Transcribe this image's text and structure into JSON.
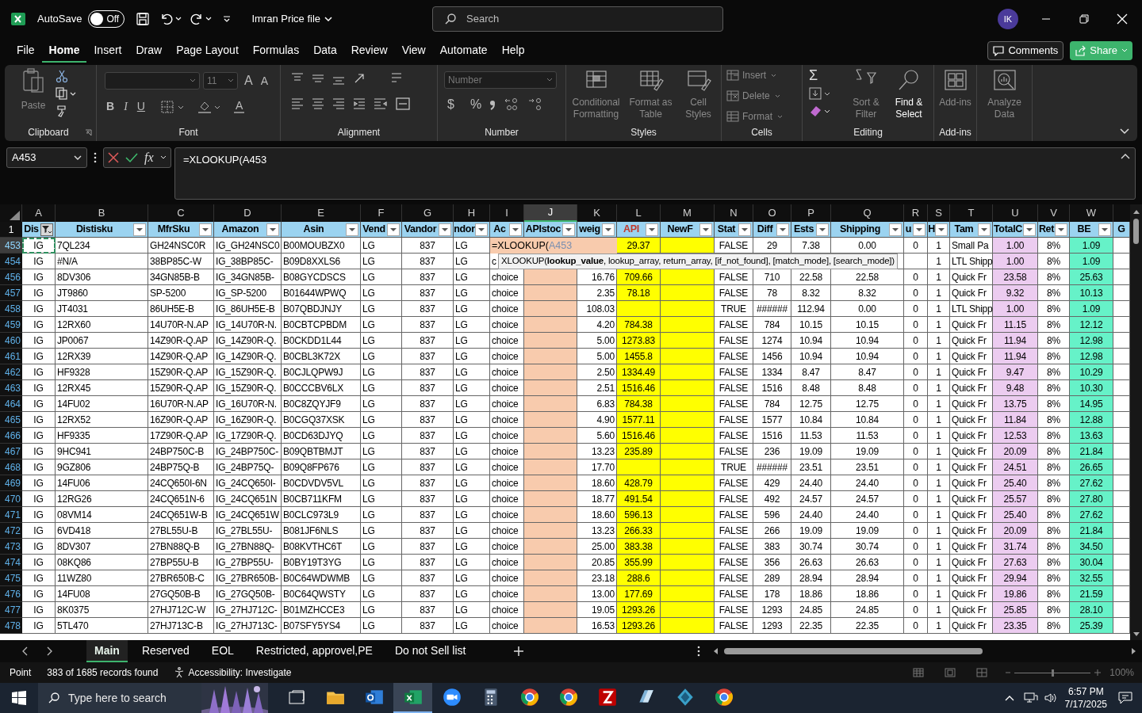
{
  "title_bar": {
    "autosave_label": "AutoSave",
    "autosave_on": false,
    "autosave_state": "Off",
    "file_name": "Imran Price file",
    "search_placeholder": "Search",
    "avatar": "IK"
  },
  "menu_tabs": [
    {
      "label": "File",
      "selected": false
    },
    {
      "label": "Home",
      "selected": true
    },
    {
      "label": "Insert",
      "selected": false
    },
    {
      "label": "Draw",
      "selected": false
    },
    {
      "label": "Page Layout",
      "selected": false
    },
    {
      "label": "Formulas",
      "selected": false
    },
    {
      "label": "Data",
      "selected": false
    },
    {
      "label": "Review",
      "selected": false
    },
    {
      "label": "View",
      "selected": false
    },
    {
      "label": "Automate",
      "selected": false
    },
    {
      "label": "Help",
      "selected": false
    }
  ],
  "actions": {
    "comments": "Comments",
    "share": "Share"
  },
  "ribbon": {
    "clipboard": {
      "label": "Clipboard",
      "paste": {
        "label": "Paste",
        "disabled": true
      }
    },
    "font": {
      "label": "Font",
      "size": "11",
      "grow": "A",
      "shrink": "A",
      "bold": "B",
      "italic": "I",
      "underline": "U",
      "font_color": "A"
    },
    "alignment": {
      "label": "Alignment"
    },
    "number": {
      "label": "Number",
      "format": "Number",
      "currency": "$",
      "percent": "%"
    },
    "styles": {
      "label": "Styles",
      "buttons": [
        {
          "label": "Conditional Formatting",
          "disabled": true
        },
        {
          "label": "Format as Table",
          "disabled": true
        },
        {
          "label": "Cell Styles",
          "disabled": true
        }
      ]
    },
    "cells": {
      "label": "Cells",
      "buttons": [
        {
          "label": "Insert",
          "disabled": true
        },
        {
          "label": "Delete",
          "disabled": true
        },
        {
          "label": "Format",
          "disabled": true
        }
      ]
    },
    "editing": {
      "label": "Editing",
      "sum": "Σ",
      "buttons": [
        {
          "label": "Sort & Filter",
          "disabled": true
        },
        {
          "label": "Find & Select",
          "disabled": false
        }
      ]
    },
    "addins": {
      "label": "Add-ins",
      "buttons": [
        {
          "label": "Add-ins",
          "disabled": true
        }
      ]
    },
    "analyze": {
      "buttons": [
        {
          "label": "Analyze Data",
          "disabled": true
        }
      ]
    }
  },
  "formula_bar": {
    "name_box": "A453",
    "function_button": "fx",
    "formula": "=XLOOKUP(A453"
  },
  "sheet": {
    "column_letters": [
      {
        "letter": "A",
        "selected": false
      },
      {
        "letter": "B",
        "selected": false
      },
      {
        "letter": "C",
        "selected": false
      },
      {
        "letter": "D",
        "selected": false
      },
      {
        "letter": "E",
        "selected": false
      },
      {
        "letter": "F",
        "selected": false
      },
      {
        "letter": "G",
        "selected": false
      },
      {
        "letter": "H",
        "selected": false
      },
      {
        "letter": "I",
        "selected": false
      },
      {
        "letter": "J",
        "selected": true
      },
      {
        "letter": "K",
        "selected": false
      },
      {
        "letter": "L",
        "selected": false
      },
      {
        "letter": "M",
        "selected": false
      },
      {
        "letter": "N",
        "selected": false
      },
      {
        "letter": "O",
        "selected": false
      },
      {
        "letter": "P",
        "selected": false
      },
      {
        "letter": "Q",
        "selected": false
      },
      {
        "letter": "R",
        "selected": false
      },
      {
        "letter": "S",
        "selected": false
      },
      {
        "letter": "T",
        "selected": false
      },
      {
        "letter": "U",
        "selected": false
      },
      {
        "letter": "V",
        "selected": false
      },
      {
        "letter": "W",
        "selected": false
      }
    ],
    "header_row": "1",
    "headers": [
      {
        "text": "Dis",
        "filtered": true
      },
      {
        "text": "Distisku",
        "filtered": false
      },
      {
        "text": "MfrSku",
        "filtered": false
      },
      {
        "text": "Amazon",
        "filtered": false
      },
      {
        "text": "Asin",
        "filtered": false
      },
      {
        "text": "Vend",
        "filtered": false
      },
      {
        "text": "Vandor",
        "filtered": false
      },
      {
        "text": "ndor",
        "filtered": false
      },
      {
        "text": "Ac",
        "filtered": false
      },
      {
        "text": "APIstoc",
        "filtered": false
      },
      {
        "text": "weig",
        "filtered": false
      },
      {
        "text": "API",
        "filtered": false
      },
      {
        "text": "NewF",
        "filtered": false
      },
      {
        "text": "Stat",
        "filtered": false
      },
      {
        "text": "Diff",
        "filtered": false
      },
      {
        "text": "Ests",
        "filtered": false
      },
      {
        "text": "Shipping",
        "filtered": false
      },
      {
        "text": "u",
        "filtered": false
      },
      {
        "text": "H",
        "filtered": false
      },
      {
        "text": "Tam",
        "filtered": false
      },
      {
        "text": "TotalC",
        "filtered": false
      },
      {
        "text": "Ret",
        "filtered": false
      },
      {
        "text": "BE",
        "filtered": false
      },
      {
        "text": "G"
      }
    ],
    "editor": {
      "function": "=XLOOKUP(",
      "reference": "A453"
    },
    "tooltip": "XLOOKUP(**lookup_value**, lookup_array, return_array, [if_not_found], [match_mode], [search_mode])",
    "rows": [
      {
        "number": "453",
        "selected": true,
        "marquee": true,
        "cells": {
          "A": "IG",
          "B": "7QL234",
          "C": "GH24NSC0R",
          "D": "IG_GH24NSC0",
          "E": "B00MOUBZX0",
          "F": "LG",
          "G": "837",
          "H": "LG",
          "L": "29.37",
          "N": "FALSE",
          "O": "29",
          "P": "7.38",
          "Q": "0.00",
          "R": "0",
          "S": "1",
          "T": "Small Pa",
          "U": "1.00",
          "V": "8%",
          "W": "1.09"
        }
      },
      {
        "number": "454",
        "selected": false,
        "marquee": false,
        "cells": {
          "A": "IG",
          "B": "#N/A",
          "C": "38BP85C-W",
          "D": "IG_38BP85C-",
          "E": "B09D8XXLS6",
          "F": "LG",
          "G": "837",
          "H": "LG",
          "I": "c",
          "S": "1",
          "T": "LTL Shipp",
          "U": "1.00",
          "V": "8%",
          "W": "1.09"
        }
      },
      {
        "number": "456",
        "selected": false,
        "marquee": false,
        "cells": {
          "A": "IG",
          "B": "8DV306",
          "C": "34GN85B-B",
          "D": "IG_34GN85B-",
          "E": "B08GYCDSCS",
          "F": "LG",
          "G": "837",
          "H": "LG",
          "I": "choice",
          "K": "16.76",
          "L": "709.66",
          "N": "FALSE",
          "O": "710",
          "P": "22.58",
          "Q": "22.58",
          "R": "0",
          "S": "1",
          "T": "Quick Fr",
          "U": "23.58",
          "V": "8%",
          "W": "25.63"
        }
      },
      {
        "number": "457",
        "selected": false,
        "marquee": false,
        "cells": {
          "A": "IG",
          "B": "JT9860",
          "C": "SP-5200",
          "D": "IG_SP-5200",
          "E": "B01644WPWQ",
          "F": "LG",
          "G": "837",
          "H": "LG",
          "I": "choice",
          "K": "2.35",
          "L": "78.18",
          "N": "FALSE",
          "O": "78",
          "P": "8.32",
          "Q": "8.32",
          "R": "0",
          "S": "1",
          "T": "Quick Fr",
          "U": "9.32",
          "V": "8%",
          "W": "10.13"
        }
      },
      {
        "number": "458",
        "selected": false,
        "marquee": false,
        "cells": {
          "A": "IG",
          "B": "JT4031",
          "C": "86UH5E-B",
          "D": "IG_86UH5E-B",
          "E": "B07QBDJNJY",
          "F": "LG",
          "G": "837",
          "H": "LG",
          "I": "choice",
          "K": "108.03",
          "N": "TRUE",
          "O": "######",
          "P": "112.94",
          "Q": "0.00",
          "R": "0",
          "S": "1",
          "T": "LTL Shipp",
          "U": "1.00",
          "V": "8%",
          "W": "1.09"
        }
      },
      {
        "number": "459",
        "selected": false,
        "marquee": false,
        "cells": {
          "A": "IG",
          "B": "12RX60",
          "C": "14U70R-N.AP",
          "D": "IG_14U70R-N.",
          "E": "B0CBTCPBDM",
          "F": "LG",
          "G": "837",
          "H": "LG",
          "I": "choice",
          "K": "4.20",
          "L": "784.38",
          "N": "FALSE",
          "O": "784",
          "P": "10.15",
          "Q": "10.15",
          "R": "0",
          "S": "1",
          "T": "Quick Fr",
          "U": "11.15",
          "V": "8%",
          "W": "12.12"
        }
      },
      {
        "number": "460",
        "selected": false,
        "marquee": false,
        "cells": {
          "A": "IG",
          "B": "JP0067",
          "C": "14Z90R-Q.AP",
          "D": "IG_14Z90R-Q.",
          "E": "B0CKDD1L44",
          "F": "LG",
          "G": "837",
          "H": "LG",
          "I": "choice",
          "K": "5.00",
          "L": "1273.83",
          "N": "FALSE",
          "O": "1274",
          "P": "10.94",
          "Q": "10.94",
          "R": "0",
          "S": "1",
          "T": "Quick Fr",
          "U": "11.94",
          "V": "8%",
          "W": "12.98"
        }
      },
      {
        "number": "461",
        "selected": false,
        "marquee": false,
        "cells": {
          "A": "IG",
          "B": "12RX39",
          "C": "14Z90R-Q.AP",
          "D": "IG_14Z90R-Q.",
          "E": "B0CBL3K72X",
          "F": "LG",
          "G": "837",
          "H": "LG",
          "I": "choice",
          "K": "5.00",
          "L": "1455.8",
          "N": "FALSE",
          "O": "1456",
          "P": "10.94",
          "Q": "10.94",
          "R": "0",
          "S": "1",
          "T": "Quick Fr",
          "U": "11.94",
          "V": "8%",
          "W": "12.98"
        }
      },
      {
        "number": "462",
        "selected": false,
        "marquee": false,
        "cells": {
          "A": "IG",
          "B": "HF9328",
          "C": "15Z90R-Q.AP",
          "D": "IG_15Z90R-Q.",
          "E": "B0CJLQPW9J",
          "F": "LG",
          "G": "837",
          "H": "LG",
          "I": "choice",
          "K": "2.50",
          "L": "1334.49",
          "N": "FALSE",
          "O": "1334",
          "P": "8.47",
          "Q": "8.47",
          "R": "0",
          "S": "1",
          "T": "Quick Fr",
          "U": "9.47",
          "V": "8%",
          "W": "10.29"
        }
      },
      {
        "number": "463",
        "selected": false,
        "marquee": false,
        "cells": {
          "A": "IG",
          "B": "12RX45",
          "C": "15Z90R-Q.AP",
          "D": "IG_15Z90R-Q.",
          "E": "B0CCCBV6LX",
          "F": "LG",
          "G": "837",
          "H": "LG",
          "I": "choice",
          "K": "2.51",
          "L": "1516.46",
          "N": "FALSE",
          "O": "1516",
          "P": "8.48",
          "Q": "8.48",
          "R": "0",
          "S": "1",
          "T": "Quick Fr",
          "U": "9.48",
          "V": "8%",
          "W": "10.30"
        }
      },
      {
        "number": "464",
        "selected": false,
        "marquee": false,
        "cells": {
          "A": "IG",
          "B": "14FU02",
          "C": "16U70R-N.AP",
          "D": "IG_16U70R-N.",
          "E": "B0C8ZQYJF9",
          "F": "LG",
          "G": "837",
          "H": "LG",
          "I": "choice",
          "K": "6.83",
          "L": "784.38",
          "N": "FALSE",
          "O": "784",
          "P": "12.75",
          "Q": "12.75",
          "R": "0",
          "S": "1",
          "T": "Quick Fr",
          "U": "13.75",
          "V": "8%",
          "W": "14.95"
        }
      },
      {
        "number": "465",
        "selected": false,
        "marquee": false,
        "cells": {
          "A": "IG",
          "B": "12RX52",
          "C": "16Z90R-Q.AP",
          "D": "IG_16Z90R-Q.",
          "E": "B0CGQ37XSK",
          "F": "LG",
          "G": "837",
          "H": "LG",
          "I": "choice",
          "K": "4.90",
          "L": "1577.11",
          "N": "FALSE",
          "O": "1577",
          "P": "10.84",
          "Q": "10.84",
          "R": "0",
          "S": "1",
          "T": "Quick Fr",
          "U": "11.84",
          "V": "8%",
          "W": "12.88"
        }
      },
      {
        "number": "466",
        "selected": false,
        "marquee": false,
        "cells": {
          "A": "IG",
          "B": "HF9335",
          "C": "17Z90R-Q.AP",
          "D": "IG_17Z90R-Q.",
          "E": "B0CD63DJYQ",
          "F": "LG",
          "G": "837",
          "H": "LG",
          "I": "choice",
          "K": "5.60",
          "L": "1516.46",
          "N": "FALSE",
          "O": "1516",
          "P": "11.53",
          "Q": "11.53",
          "R": "0",
          "S": "1",
          "T": "Quick Fr",
          "U": "12.53",
          "V": "8%",
          "W": "13.63"
        }
      },
      {
        "number": "467",
        "selected": false,
        "marquee": false,
        "cells": {
          "A": "IG",
          "B": "9HC941",
          "C": "24BP750C-B",
          "D": "IG_24BP750C-",
          "E": "B09QBTBMJT",
          "F": "LG",
          "G": "837",
          "H": "LG",
          "I": "choice",
          "K": "13.23",
          "L": "235.89",
          "N": "FALSE",
          "O": "236",
          "P": "19.09",
          "Q": "19.09",
          "R": "0",
          "S": "1",
          "T": "Quick Fr",
          "U": "20.09",
          "V": "8%",
          "W": "21.84"
        }
      },
      {
        "number": "468",
        "selected": false,
        "marquee": false,
        "cells": {
          "A": "IG",
          "B": "9GZ806",
          "C": "24BP75Q-B",
          "D": "IG_24BP75Q-",
          "E": "B09Q8FP676",
          "F": "LG",
          "G": "837",
          "H": "LG",
          "I": "choice",
          "K": "17.70",
          "N": "TRUE",
          "O": "######",
          "P": "23.51",
          "Q": "23.51",
          "R": "0",
          "S": "1",
          "T": "Quick Fr",
          "U": "24.51",
          "V": "8%",
          "W": "26.65"
        }
      },
      {
        "number": "469",
        "selected": false,
        "marquee": false,
        "cells": {
          "A": "IG",
          "B": "14FU06",
          "C": "24CQ650I-6N",
          "D": "IG_24CQ650I-",
          "E": "B0CDVDV5VL",
          "F": "LG",
          "G": "837",
          "H": "LG",
          "I": "choice",
          "K": "18.60",
          "L": "428.79",
          "N": "FALSE",
          "O": "429",
          "P": "24.40",
          "Q": "24.40",
          "R": "0",
          "S": "1",
          "T": "Quick Fr",
          "U": "25.40",
          "V": "8%",
          "W": "27.62"
        }
      },
      {
        "number": "470",
        "selected": false,
        "marquee": false,
        "cells": {
          "A": "IG",
          "B": "12RG26",
          "C": "24CQ651N-6",
          "D": "IG_24CQ651N",
          "E": "B0CB711KFM",
          "F": "LG",
          "G": "837",
          "H": "LG",
          "I": "choice",
          "K": "18.77",
          "L": "491.54",
          "N": "FALSE",
          "O": "492",
          "P": "24.57",
          "Q": "24.57",
          "R": "0",
          "S": "1",
          "T": "Quick Fr",
          "U": "25.57",
          "V": "8%",
          "W": "27.80"
        }
      },
      {
        "number": "471",
        "selected": false,
        "marquee": false,
        "cells": {
          "A": "IG",
          "B": "08VM14",
          "C": "24CQ651W-B",
          "D": "IG_24CQ651W",
          "E": "B0CLC973L9",
          "F": "LG",
          "G": "837",
          "H": "LG",
          "I": "choice",
          "K": "18.60",
          "L": "596.13",
          "N": "FALSE",
          "O": "596",
          "P": "24.40",
          "Q": "24.40",
          "R": "0",
          "S": "1",
          "T": "Quick Fr",
          "U": "25.40",
          "V": "8%",
          "W": "27.62"
        }
      },
      {
        "number": "472",
        "selected": false,
        "marquee": false,
        "cells": {
          "A": "IG",
          "B": "6VD418",
          "C": "27BL55U-B",
          "D": "IG_27BL55U-",
          "E": "B081JF6NLS",
          "F": "LG",
          "G": "837",
          "H": "LG",
          "I": "choice",
          "K": "13.23",
          "L": "266.33",
          "N": "FALSE",
          "O": "266",
          "P": "19.09",
          "Q": "19.09",
          "R": "0",
          "S": "1",
          "T": "Quick Fr",
          "U": "20.09",
          "V": "8%",
          "W": "21.84"
        }
      },
      {
        "number": "473",
        "selected": false,
        "marquee": false,
        "cells": {
          "A": "IG",
          "B": "8DV307",
          "C": "27BN88Q-B",
          "D": "IG_27BN88Q-",
          "E": "B08KVTHC6T",
          "F": "LG",
          "G": "837",
          "H": "LG",
          "I": "choice",
          "K": "25.00",
          "L": "383.38",
          "N": "FALSE",
          "O": "383",
          "P": "30.74",
          "Q": "30.74",
          "R": "0",
          "S": "1",
          "T": "Quick Fr",
          "U": "31.74",
          "V": "8%",
          "W": "34.50"
        }
      },
      {
        "number": "474",
        "selected": false,
        "marquee": false,
        "cells": {
          "A": "IG",
          "B": "08KQ86",
          "C": "27BP55U-B",
          "D": "IG_27BP55U-",
          "E": "B0BY19T3YG",
          "F": "LG",
          "G": "837",
          "H": "LG",
          "I": "choice",
          "K": "20.85",
          "L": "355.99",
          "N": "FALSE",
          "O": "356",
          "P": "26.63",
          "Q": "26.63",
          "R": "0",
          "S": "1",
          "T": "Quick Fr",
          "U": "27.63",
          "V": "8%",
          "W": "30.04"
        }
      },
      {
        "number": "475",
        "selected": false,
        "marquee": false,
        "cells": {
          "A": "IG",
          "B": "11WZ80",
          "C": "27BR650B-C",
          "D": "IG_27BR650B-",
          "E": "B0C64WDWMB",
          "F": "LG",
          "G": "837",
          "H": "LG",
          "I": "choice",
          "K": "23.18",
          "L": "288.6",
          "N": "FALSE",
          "O": "289",
          "P": "28.94",
          "Q": "28.94",
          "R": "0",
          "S": "1",
          "T": "Quick Fr",
          "U": "29.94",
          "V": "8%",
          "W": "32.55"
        }
      },
      {
        "number": "476",
        "selected": false,
        "marquee": false,
        "cells": {
          "A": "IG",
          "B": "14FU08",
          "C": "27GQ50B-B",
          "D": "IG_27GQ50B-",
          "E": "B0C64QWSTY",
          "F": "LG",
          "G": "837",
          "H": "LG",
          "I": "choice",
          "K": "13.00",
          "L": "177.69",
          "N": "FALSE",
          "O": "178",
          "P": "18.86",
          "Q": "18.86",
          "R": "0",
          "S": "1",
          "T": "Quick Fr",
          "U": "19.86",
          "V": "8%",
          "W": "21.59"
        }
      },
      {
        "number": "477",
        "selected": false,
        "marquee": false,
        "cells": {
          "A": "IG",
          "B": "8K0375",
          "C": "27HJ712C-W",
          "D": "IG_27HJ712C-",
          "E": "B01MZHCCE3",
          "F": "LG",
          "G": "837",
          "H": "LG",
          "I": "choice",
          "K": "19.05",
          "L": "1293.26",
          "N": "FALSE",
          "O": "1293",
          "P": "24.85",
          "Q": "24.85",
          "R": "0",
          "S": "1",
          "T": "Quick Fr",
          "U": "25.85",
          "V": "8%",
          "W": "28.10"
        }
      },
      {
        "number": "478",
        "selected": false,
        "marquee": false,
        "cells": {
          "A": "IG",
          "B": "5TL470",
          "C": "27HJ713C-B",
          "D": "IG_27HJ713C-",
          "E": "B07SFY5YS4",
          "F": "LG",
          "G": "837",
          "H": "LG",
          "I": "choice",
          "K": "16.53",
          "L": "1293.26",
          "N": "FALSE",
          "O": "1293",
          "P": "22.35",
          "Q": "22.35",
          "R": "0",
          "S": "1",
          "T": "Quick Fr",
          "U": "23.35",
          "V": "8%",
          "W": "25.39"
        }
      }
    ]
  },
  "sheet_tabs": [
    {
      "label": "Main",
      "selected": true
    },
    {
      "label": "Reserved",
      "selected": false
    },
    {
      "label": "EOL",
      "selected": false
    },
    {
      "label": "Restricted, approvel,PE",
      "selected": false
    },
    {
      "label": "Do not Sell list",
      "selected": false
    }
  ],
  "status_bar": {
    "mode": "Point",
    "records": "383 of 1685 records found",
    "accessibility": "Accessibility: Investigate",
    "zoom": "100%",
    "zoom_slider": {
      "level": 0.5
    }
  },
  "taskbar": {
    "search_placeholder": "Type here to search",
    "time": "6:57 PM",
    "date": "7/17/2025",
    "apps": [
      {
        "selected": false
      },
      {
        "selected": false
      },
      {
        "selected": true
      },
      {
        "selected": false
      },
      {
        "selected": false
      },
      {
        "selected": false
      },
      {
        "selected": false
      },
      {
        "selected": false
      },
      {
        "selected": false
      },
      {
        "selected": false
      },
      {
        "selected": false
      }
    ]
  }
}
